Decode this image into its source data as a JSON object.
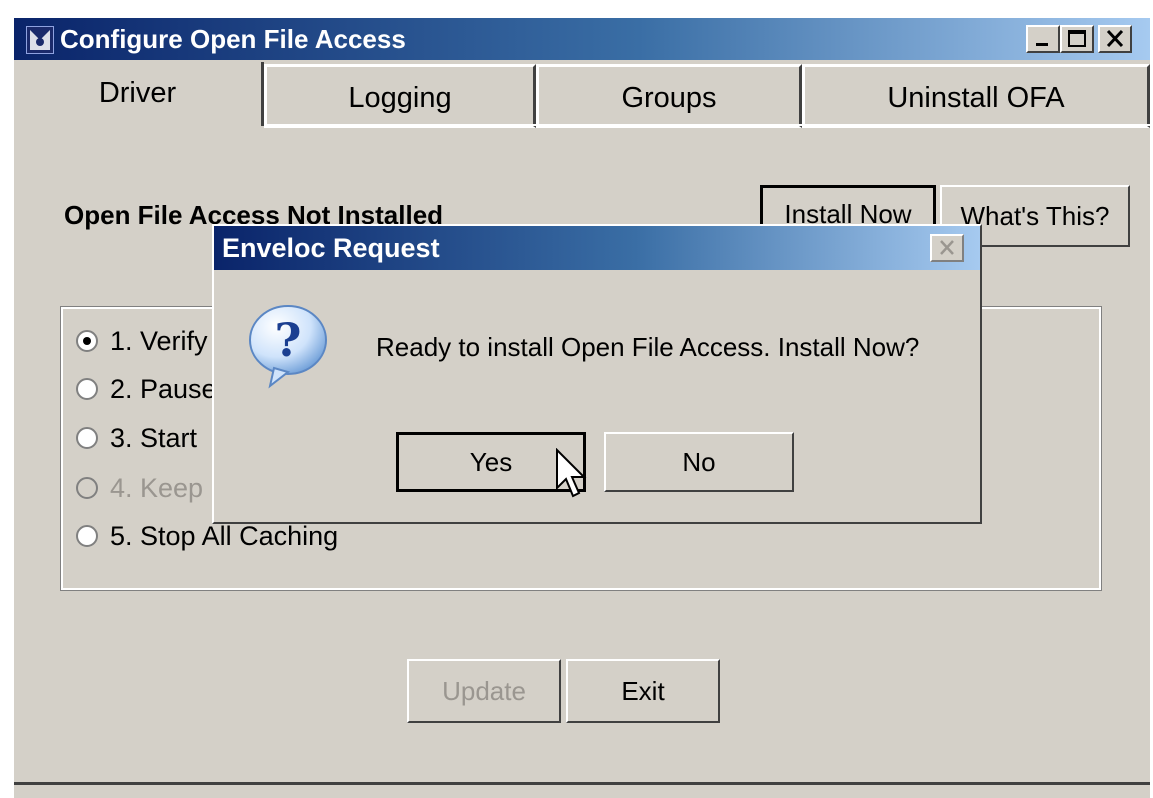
{
  "window": {
    "title": "Configure Open File Access",
    "controls": {
      "minimize_icon": "minimize-icon",
      "maximize_icon": "maximize-icon",
      "close_icon": "close-icon"
    }
  },
  "tabs": [
    {
      "label": "Driver",
      "active": true
    },
    {
      "label": "Logging",
      "active": false
    },
    {
      "label": "Groups",
      "active": false
    },
    {
      "label": "Uninstall OFA",
      "active": false
    }
  ],
  "driver": {
    "status": "Open File Access Not Installed",
    "install_now": "Install Now",
    "whats_this": "What's This?",
    "options": [
      {
        "label": "1. Verify",
        "selected": true,
        "enabled": true
      },
      {
        "label": "2. Pause",
        "selected": false,
        "enabled": true
      },
      {
        "label": "3. Start",
        "selected": false,
        "enabled": true
      },
      {
        "label": "4. Keep",
        "selected": false,
        "enabled": false
      },
      {
        "label": "5. Stop All Caching",
        "selected": false,
        "enabled": true
      }
    ],
    "update": "Update",
    "exit": "Exit"
  },
  "dialog": {
    "title": "Enveloc Request",
    "icon": "question-icon",
    "message": "Ready to install Open File Access.  Install Now?",
    "yes": "Yes",
    "no": "No"
  },
  "colors": {
    "titlebar_start": "#0a246a",
    "titlebar_end": "#a6caf0",
    "face": "#d4d0c8"
  }
}
